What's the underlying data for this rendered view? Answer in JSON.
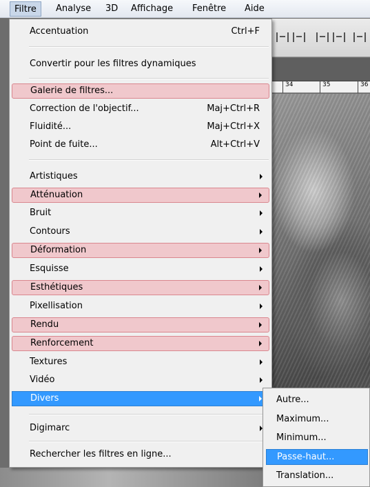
{
  "menubar": {
    "items": [
      "Filtre",
      "Analyse",
      "3D",
      "Affichage",
      "Fenêtre",
      "Aide"
    ],
    "active": "Filtre"
  },
  "ruler": {
    "ticks": [
      "34",
      "35",
      "36"
    ]
  },
  "filter_menu": {
    "last_filter": {
      "label": "Accentuation",
      "shortcut": "Ctrl+F"
    },
    "smart_filters": {
      "label": "Convertir pour les filtres dynamiques"
    },
    "galerie": {
      "label": "Galerie de filtres..."
    },
    "correction": {
      "label": "Correction de l'objectif...",
      "shortcut": "Maj+Ctrl+R"
    },
    "fluidite": {
      "label": "Fluidité...",
      "shortcut": "Maj+Ctrl+X"
    },
    "point_fuite": {
      "label": "Point de fuite...",
      "shortcut": "Alt+Ctrl+V"
    },
    "categories": [
      {
        "label": "Artistiques"
      },
      {
        "label": "Atténuation"
      },
      {
        "label": "Bruit"
      },
      {
        "label": "Contours"
      },
      {
        "label": "Déformation"
      },
      {
        "label": "Esquisse"
      },
      {
        "label": "Esthétiques"
      },
      {
        "label": "Pixellisation"
      },
      {
        "label": "Rendu"
      },
      {
        "label": "Renforcement"
      },
      {
        "label": "Textures"
      },
      {
        "label": "Vidéo"
      },
      {
        "label": "Divers"
      }
    ],
    "digimarc": {
      "label": "Digimarc"
    },
    "online": {
      "label": "Rechercher les filtres en ligne..."
    }
  },
  "submenu_divers": {
    "items": [
      "Autre...",
      "Maximum...",
      "Minimum...",
      "Passe-haut...",
      "Translation..."
    ],
    "selected": "Passe-haut..."
  },
  "colors": {
    "highlight_fill": "#f0c8cc",
    "highlight_border": "#d9868e",
    "selection": "#3399ff"
  }
}
